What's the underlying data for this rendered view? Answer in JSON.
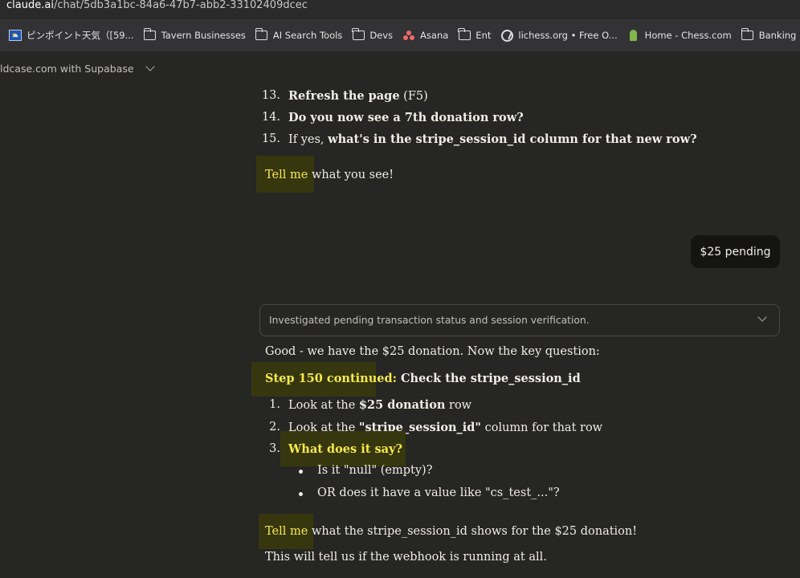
{
  "browser": {
    "url_host": "claude.ai",
    "url_path": "/chat/5db3a1bc-84a6-47b7-abb2-33102409dcec",
    "bookmarks": [
      {
        "label": "ピンポイント天気（[59...",
        "icon": "weather-favicon"
      },
      {
        "label": "Tavern Businesses",
        "icon": "folder-icon"
      },
      {
        "label": "AI Search Tools",
        "icon": "folder-icon"
      },
      {
        "label": "Devs",
        "icon": "folder-icon"
      },
      {
        "label": "Asana",
        "icon": "asana-icon"
      },
      {
        "label": "Ent",
        "icon": "folder-icon"
      },
      {
        "label": "lichess.org • Free O...",
        "icon": "lichess-icon"
      },
      {
        "label": "Home - Chess.com",
        "icon": "chess-pawn-icon"
      },
      {
        "label": "Banking",
        "icon": "folder-icon"
      }
    ]
  },
  "conversation": {
    "title": "ldcase.com with Supabase"
  },
  "messages": {
    "prev": {
      "items": [
        {
          "num": "13.",
          "text": "Refresh the page",
          "suffix": " (F5)"
        },
        {
          "num": "14.",
          "text": "Do you now see a 7th donation row?"
        },
        {
          "num": "15.",
          "pre": "If yes, ",
          "text": "what's in the stripe_session_id column for that new row?"
        }
      ],
      "tell_hl": "Tell me",
      "tell_rest": " what you see!"
    },
    "user": "$25 pending",
    "assistant": {
      "thinking_summary": "Investigated pending transaction status and session verification.",
      "intro": "Good - we have the $25 donation. Now the key question:",
      "step_label": "Step 150 continued:",
      "step_rest": " Check the stripe_session_id",
      "items": [
        {
          "num": "1.",
          "pre": "Look at the ",
          "bold": "$25 donation",
          "post": " row"
        },
        {
          "num": "2.",
          "pre": "Look at the ",
          "bold": "\"stripe_session_id\"",
          "post": " column for that row"
        },
        {
          "num": "3.",
          "bold": "What does it say?"
        }
      ],
      "subitems": [
        "Is it \"null\" (empty)?",
        "OR does it have a value like \"cs_test_...\"?"
      ],
      "tell_hl": "Tell me",
      "tell_rest": " what the stripe_session_id shows for the $25 donation!",
      "closing": "This will tell us if the webhook is running at all."
    }
  },
  "colors": {
    "background": "#262624",
    "highlight_text": "#f7e94a",
    "user_bubble": "#141413"
  }
}
